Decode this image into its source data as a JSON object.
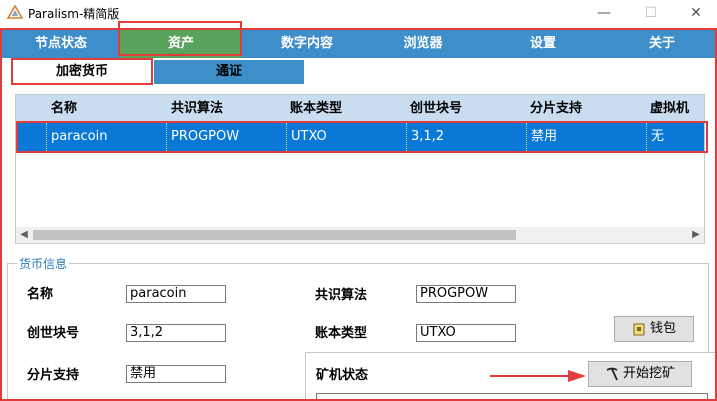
{
  "window": {
    "title": "Paralism-精简版",
    "minimize": "—",
    "maximize": "☐",
    "close": "✕",
    "icon": "triangle-logo-icon"
  },
  "menu": {
    "items": [
      "节点状态",
      "资产",
      "数字内容",
      "浏览器",
      "设置",
      "关于"
    ],
    "active": "资产"
  },
  "subtabs": {
    "items": [
      "加密货币",
      "通证"
    ],
    "active": "加密货币"
  },
  "table": {
    "columns": [
      "名称",
      "共识算法",
      "账本类型",
      "创世块号",
      "分片支持",
      "虚拟机"
    ],
    "rows": [
      [
        "paracoin",
        "PROGPOW",
        "UTXO",
        "3,1,2",
        "禁用",
        "无"
      ]
    ],
    "scroll_left": "◀",
    "scroll_right": "▶"
  },
  "currency_info": {
    "legend": "货币信息",
    "name_label": "名称",
    "name_value": "paracoin",
    "consensus_label": "共识算法",
    "consensus_value": "PROGPOW",
    "genesis_label": "创世块号",
    "genesis_value": "3,1,2",
    "ledger_label": "账本类型",
    "ledger_value": "UTXO",
    "shard_label": "分片支持",
    "shard_value": "禁用",
    "miner_label": "矿机状态",
    "wallet_button": "钱包",
    "wallet_icon": "wallet-icon",
    "mine_button": "开始挖矿",
    "mine_icon": "pickaxe-icon"
  },
  "colors": {
    "menu_bg": "#3d8ec9",
    "menu_active": "#5aa35d",
    "selected_row": "#0a78d7",
    "header_bg": "#c9ddf0",
    "highlight": "#e23b3b"
  }
}
